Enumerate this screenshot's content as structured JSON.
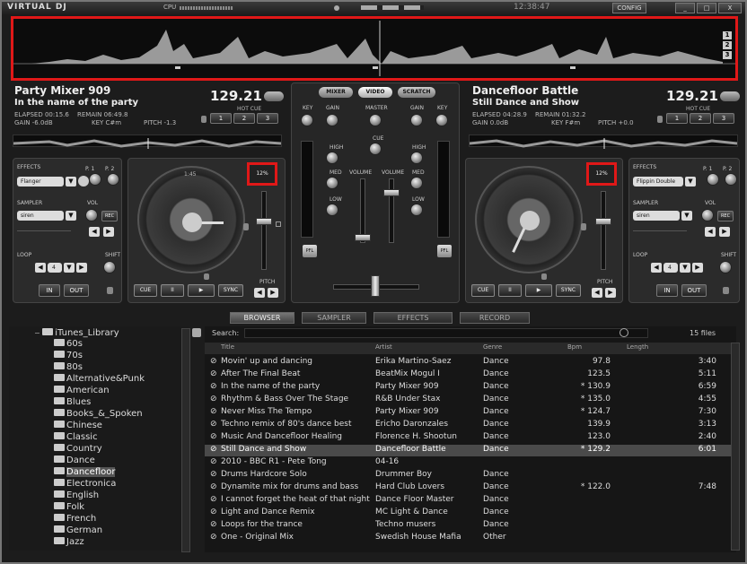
{
  "app": {
    "logo": "VIRTUAL DJ",
    "cpu_label": "CPU",
    "clock": "12:38:47",
    "config_label": "CONFIG",
    "minimize": "_",
    "maximize": "□",
    "close": "X"
  },
  "overview": {
    "markers": [
      "1",
      "2",
      "3"
    ]
  },
  "deck_left": {
    "title": "Party Mixer 909",
    "subtitle": "In the name of the party",
    "bpm": "129.21",
    "elapsed": "ELAPSED 00:15.6",
    "remain": "REMAIN 06:49.8",
    "gain": "GAIN -6.0dB",
    "key": "KEY C#m",
    "pitch": "PITCH -1.3",
    "hotcue_label": "HOT CUE",
    "hotcues": [
      "1",
      "2",
      "3"
    ],
    "effects_label": "EFFECTS",
    "effect": "Flanger",
    "p1": "P. 1",
    "p2": "P. 2",
    "sampler_label": "SAMPLER",
    "sampler": "siren",
    "vol": "VOL",
    "rec": "REC",
    "loop_label": "LOOP",
    "loop_value": "4",
    "shift": "SHIFT",
    "in": "IN",
    "out": "OUT",
    "pitch_pct": "12%",
    "pitch_label": "PITCH",
    "cue": "CUE",
    "pause": "II",
    "play": "▶",
    "sync": "SYNC",
    "platter_time": "1:45"
  },
  "deck_right": {
    "title": "Dancefloor Battle",
    "subtitle": "Still Dance and Show",
    "bpm": "129.21",
    "elapsed": "ELAPSED 04:28.9",
    "remain": "REMAIN 01:32.2",
    "gain": "GAIN 0.0dB",
    "key": "KEY F#m",
    "pitch": "PITCH +0.0",
    "hotcue_label": "HOT CUE",
    "hotcues": [
      "1",
      "2",
      "3"
    ],
    "effects_label": "EFFECTS",
    "effect": "Flippin Double",
    "p1": "P. 1",
    "p2": "P. 2",
    "sampler_label": "SAMPLER",
    "sampler": "siren",
    "vol": "VOL",
    "rec": "REC",
    "loop_label": "LOOP",
    "loop_value": "4",
    "shift": "SHIFT",
    "in": "IN",
    "out": "OUT",
    "pitch_pct": "12%",
    "pitch_label": "PITCH",
    "cue": "CUE",
    "pause": "II",
    "play": "▶",
    "sync": "SYNC"
  },
  "mixer": {
    "tabs": [
      "MIXER",
      "VIDEO",
      "SCRATCH"
    ],
    "key": "KEY",
    "gain": "GAIN",
    "master": "MASTER",
    "cue": "CUE",
    "high": "HIGH",
    "med": "MED",
    "low": "LOW",
    "volume": "VOLUME",
    "pfl": "PFL"
  },
  "browser": {
    "tabs": [
      "BROWSER",
      "SAMPLER",
      "EFFECTS",
      "RECORD"
    ],
    "search_label": "Search:",
    "file_count": "15 files",
    "columns": [
      "Title",
      "Artist",
      "Genre",
      "Bpm",
      "Length"
    ],
    "tree_root": "iTunes_Library",
    "folders": [
      "60s",
      "70s",
      "80s",
      "Alternative&Punk",
      "American",
      "Blues",
      "Books_&_Spoken",
      "Chinese",
      "Classic",
      "Country",
      "Dance",
      "Dancefloor",
      "Electronica",
      "English",
      "Folk",
      "French",
      "German",
      "Jazz"
    ],
    "selected_folder": "Dancefloor",
    "tracks": [
      {
        "title": "Movin' up and dancing",
        "artist": "Erika Martino-Saez",
        "genre": "Dance",
        "bpm": "97.8",
        "length": "3:40"
      },
      {
        "title": "After The Final Beat",
        "artist": "BeatMix Mogul I",
        "genre": "Dance",
        "bpm": "123.5",
        "length": "5:11"
      },
      {
        "title": "In the name of the party",
        "artist": "Party Mixer 909",
        "genre": "Dance",
        "bpm": "* 130.9",
        "length": "6:59"
      },
      {
        "title": "Rhythm & Bass Over The Stage",
        "artist": "R&B Under Stax",
        "genre": "Dance",
        "bpm": "* 135.0",
        "length": "4:55"
      },
      {
        "title": "Never Miss The Tempo",
        "artist": "Party Mixer 909",
        "genre": "Dance",
        "bpm": "* 124.7",
        "length": "7:30"
      },
      {
        "title": "Techno remix of 80's dance best",
        "artist": "Ericho Daronzales",
        "genre": "Dance",
        "bpm": "139.9",
        "length": "3:13"
      },
      {
        "title": "Music And Dancefloor Healing",
        "artist": "Florence H. Shootun",
        "genre": "Dance",
        "bpm": "123.0",
        "length": "2:40"
      },
      {
        "title": "Still Dance and Show",
        "artist": "Dancefloor Battle",
        "genre": "Dance",
        "bpm": "* 129.2",
        "length": "6:01"
      },
      {
        "title": "2010 - BBC R1 - Pete Tong",
        "artist": "04-16",
        "genre": "",
        "bpm": "",
        "length": ""
      },
      {
        "title": "Drums Hardcore Solo",
        "artist": "Drummer Boy",
        "genre": "Dance",
        "bpm": "",
        "length": ""
      },
      {
        "title": "Dynamite mix for drums and bass",
        "artist": "Hard Club Lovers",
        "genre": "Dance",
        "bpm": "* 122.0",
        "length": "7:48"
      },
      {
        "title": "I cannot forget the heat of that night",
        "artist": "Dance Floor Master",
        "genre": "Dance",
        "bpm": "",
        "length": ""
      },
      {
        "title": "Light and Dance Remix",
        "artist": "MC Light & Dance",
        "genre": "Dance",
        "bpm": "",
        "length": ""
      },
      {
        "title": "Loops for the trance",
        "artist": "Techno musers",
        "genre": "Dance",
        "bpm": "",
        "length": ""
      },
      {
        "title": "One - Original Mix",
        "artist": "Swedish House Mafia",
        "genre": "Other",
        "bpm": "",
        "length": ""
      }
    ]
  }
}
